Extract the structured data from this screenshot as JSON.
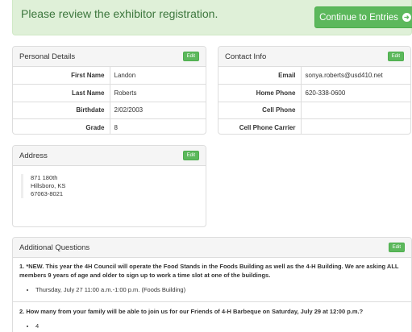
{
  "alert": {
    "message": "Please review the exhibitor registration.",
    "continue_label": "Continue to Entries"
  },
  "icons": {
    "continue_arrow": "arrow-right-circle-icon"
  },
  "colors": {
    "alert_bg": "#dff0d8",
    "alert_text": "#3c763d",
    "success": "#5cb85c"
  },
  "personal": {
    "title": "Personal Details",
    "edit_label": "Edit",
    "rows": [
      {
        "label": "First Name",
        "value": "Landon"
      },
      {
        "label": "Last Name",
        "value": "Roberts"
      },
      {
        "label": "Birthdate",
        "value": "2/02/2003"
      },
      {
        "label": "Grade",
        "value": "8"
      }
    ]
  },
  "contact": {
    "title": "Contact Info",
    "edit_label": "Edit",
    "rows": [
      {
        "label": "Email",
        "value": "sonya.roberts@usd410.net"
      },
      {
        "label": "Home Phone",
        "value": "620-338-0600"
      },
      {
        "label": "Cell Phone",
        "value": ""
      },
      {
        "label": "Cell Phone Carrier",
        "value": ""
      }
    ]
  },
  "address": {
    "title": "Address",
    "edit_label": "Edit",
    "line1": "871 180th",
    "line2": "Hillsboro, KS",
    "line3": "67063-8021"
  },
  "questions": {
    "title": "Additional Questions",
    "edit_label": "Edit",
    "items": [
      {
        "question": "1. *NEW. This year the 4H Council will operate the Food Stands in the Foods Building as well as the 4-H Building. We are asking ALL members 9 years of age and older to sign up to work a time slot at one of the buildings.",
        "answer": "Thursday, July 27 11:00 a.m.-1:00 p.m. (Foods Building)"
      },
      {
        "question": "2. How many from your family will be able to join us for our Friends of 4-H Barbeque on Saturday, July 29 at 12:00 p.m.?",
        "answer": "4"
      }
    ]
  }
}
